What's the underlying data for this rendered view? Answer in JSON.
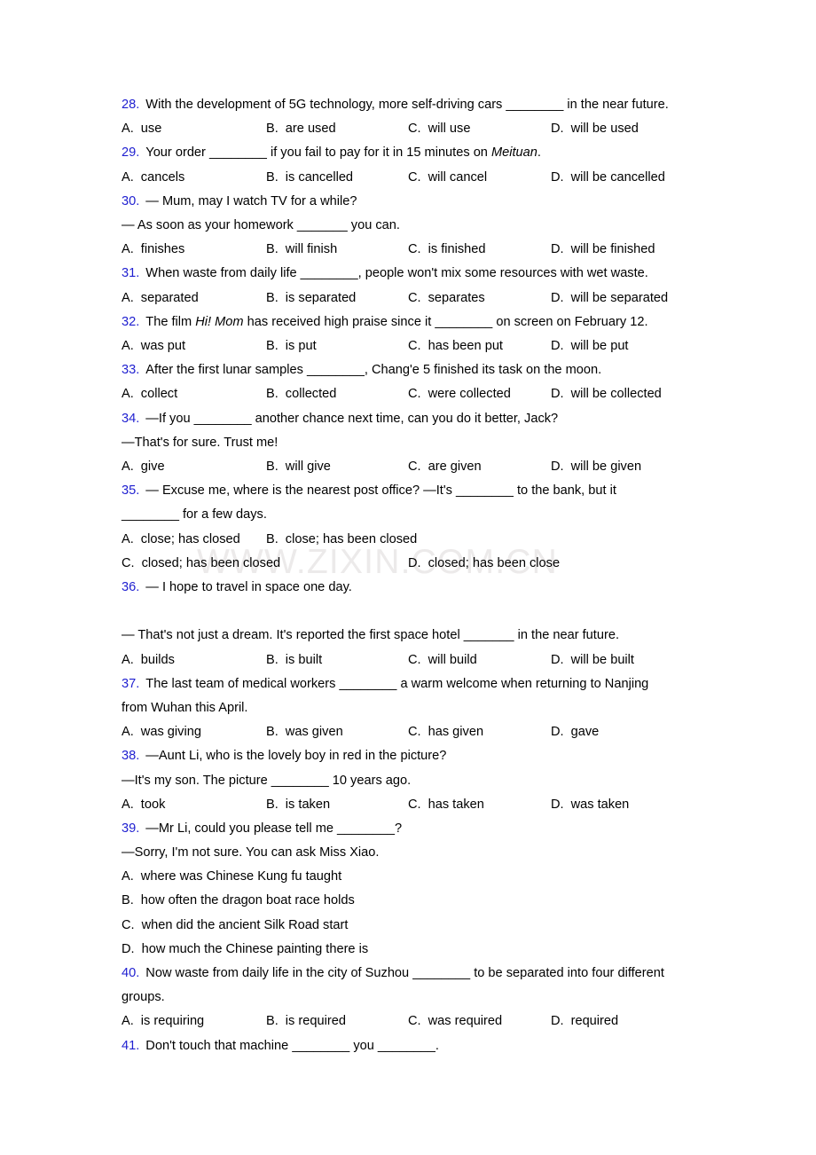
{
  "document": {
    "watermark": "WWW.ZIXIN.COM.CN",
    "accent_color": "#1f1fd0",
    "text_color": "#000000",
    "background_color": "#ffffff"
  },
  "questions": [
    {
      "number": "28.",
      "lines": [
        "With the development of 5G technology, more self-driving cars ________ in the near future."
      ],
      "options": [
        {
          "label": "A.",
          "text": "use"
        },
        {
          "label": "B.",
          "text": "are used"
        },
        {
          "label": "C.",
          "text": "will use"
        },
        {
          "label": "D.",
          "text": "will be used"
        }
      ]
    },
    {
      "number": "29.",
      "lines": [
        "Your order ________ if you fail to pay for it in 15 minutes on Meituan."
      ],
      "italic_part": "Meituan",
      "options": [
        {
          "label": "A.",
          "text": "cancels"
        },
        {
          "label": "B.",
          "text": "is cancelled"
        },
        {
          "label": "C.",
          "text": "will cancel"
        },
        {
          "label": "D.",
          "text": "will be cancelled"
        }
      ]
    },
    {
      "number": "30.",
      "lines": [
        "— Mum, may I watch TV for a while?",
        "— As soon as your homework _______ you can."
      ],
      "options": [
        {
          "label": "A.",
          "text": "finishes"
        },
        {
          "label": "B.",
          "text": "will finish"
        },
        {
          "label": "C.",
          "text": "is finished"
        },
        {
          "label": "D.",
          "text": "will be finished"
        }
      ]
    },
    {
      "number": "31.",
      "lines": [
        "When waste from daily life ________, people won't mix some resources with wet waste."
      ],
      "options": [
        {
          "label": "A.",
          "text": "separated"
        },
        {
          "label": "B.",
          "text": "is separated"
        },
        {
          "label": "C.",
          "text": "separates"
        },
        {
          "label": "D.",
          "text": "will be separated"
        }
      ]
    },
    {
      "number": "32.",
      "lines": [
        "The film Hi! Mom has received high praise since it ________ on screen on February 12."
      ],
      "italic_part": "Hi! Mom",
      "options": [
        {
          "label": "A.",
          "text": "was put"
        },
        {
          "label": "B.",
          "text": "is put"
        },
        {
          "label": "C.",
          "text": "has been put"
        },
        {
          "label": "D.",
          "text": "will be put"
        }
      ]
    },
    {
      "number": "33.",
      "lines": [
        "After the first lunar samples ________, Chang'e 5 finished its task on the moon."
      ],
      "options": [
        {
          "label": "A.",
          "text": "collect"
        },
        {
          "label": "B.",
          "text": "collected"
        },
        {
          "label": "C.",
          "text": "were collected"
        },
        {
          "label": "D.",
          "text": "will be collected"
        }
      ]
    },
    {
      "number": "34.",
      "lines": [
        "—If you ________ another chance next time, can you do it better, Jack?",
        "—That's for sure. Trust me!"
      ],
      "options": [
        {
          "label": "A.",
          "text": "give"
        },
        {
          "label": "B.",
          "text": "will give"
        },
        {
          "label": "C.",
          "text": "are given"
        },
        {
          "label": "D.",
          "text": "will be given"
        }
      ]
    },
    {
      "number": "35.",
      "lines": [
        "— Excuse me, where is the nearest post office?  —It's ________ to the bank, but it",
        "________ for a few days."
      ],
      "options": [
        {
          "label": "A.",
          "text": "close; has closed"
        },
        {
          "label": "B.",
          "text": "close; has been closed"
        },
        {
          "label": "C.",
          "text": "closed; has been closed"
        },
        {
          "label": "D.",
          "text": "closed; has been close"
        }
      ]
    },
    {
      "number": "36.",
      "lines": [
        "— I hope to travel in space one day.",
        "",
        "— That's not just a dream. It's reported the first space hotel _______ in the near future."
      ],
      "options": [
        {
          "label": "A.",
          "text": "builds"
        },
        {
          "label": "B.",
          "text": "is built"
        },
        {
          "label": "C.",
          "text": "will build"
        },
        {
          "label": "D.",
          "text": "will be built"
        }
      ]
    },
    {
      "number": "37.",
      "lines": [
        "The last team of medical workers ________ a warm welcome when returning to Nanjing",
        "from Wuhan this April."
      ],
      "options": [
        {
          "label": "A.",
          "text": "was giving"
        },
        {
          "label": "B.",
          "text": "was given"
        },
        {
          "label": "C.",
          "text": "has given"
        },
        {
          "label": "D.",
          "text": "gave"
        }
      ]
    },
    {
      "number": "38.",
      "lines": [
        "—Aunt Li, who is the lovely boy in red in the picture?",
        "—It's my son. The picture ________ 10 years ago."
      ],
      "options": [
        {
          "label": "A.",
          "text": "took"
        },
        {
          "label": "B.",
          "text": "is taken"
        },
        {
          "label": "C.",
          "text": "has taken"
        },
        {
          "label": "D.",
          "text": "was taken"
        }
      ]
    },
    {
      "number": "39.",
      "lines": [
        "—Mr Li, could you please tell me ________?",
        "—Sorry, I'm not sure. You can ask Miss Xiao."
      ],
      "options": [
        {
          "label": "A.",
          "text": "where was Chinese Kung fu taught"
        },
        {
          "label": "B.",
          "text": "how often the dragon boat race holds"
        },
        {
          "label": "C.",
          "text": "when did the ancient Silk Road start"
        },
        {
          "label": "D.",
          "text": "how much the Chinese painting there is"
        }
      ]
    },
    {
      "number": "40.",
      "lines": [
        "Now waste from daily life in the city of Suzhou ________ to be separated into four different",
        "groups."
      ],
      "options": [
        {
          "label": "A.",
          "text": "is requiring"
        },
        {
          "label": "B.",
          "text": "is required"
        },
        {
          "label": "C.",
          "text": "was required"
        },
        {
          "label": "D.",
          "text": "required"
        }
      ]
    },
    {
      "number": "41.",
      "lines": [
        "Don't touch that machine ________ you ________."
      ],
      "options": []
    }
  ]
}
